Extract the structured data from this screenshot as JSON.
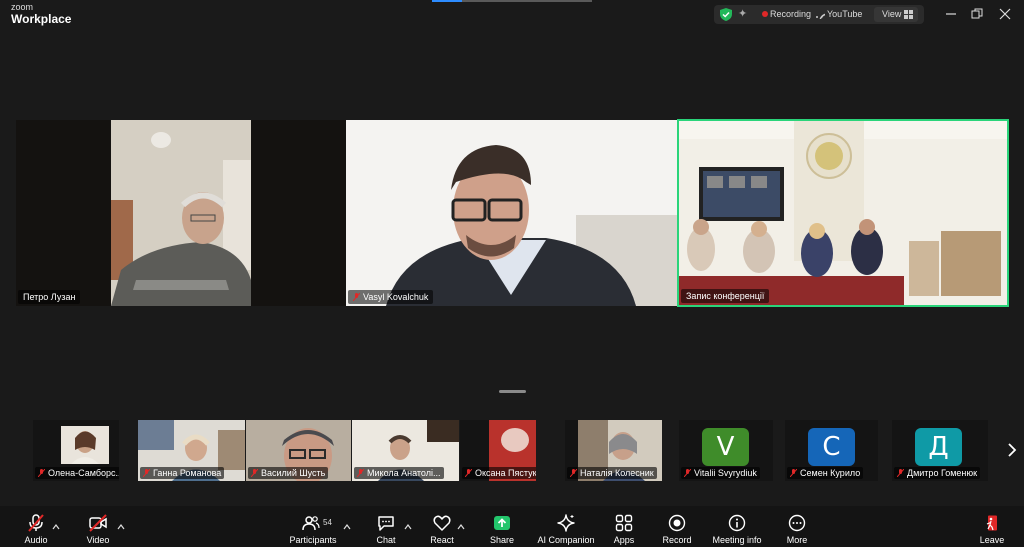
{
  "app": {
    "logo_top": "zoom",
    "logo_bottom": "Workplace"
  },
  "status": {
    "recording": "Recording",
    "stream": "YouTube",
    "view": "View"
  },
  "colors": {
    "active_speaker": "#2ad47a",
    "recording": "#e02828",
    "shield": "#23b85a",
    "share": "#23c66c",
    "leave": "#e02828"
  },
  "tiles": [
    {
      "name": "Петро Лузан",
      "muted": false
    },
    {
      "name": "Vasyl Kovalchuk",
      "muted": true
    },
    {
      "name": "Запис конференції",
      "muted": false,
      "active": true
    }
  ],
  "thumbnails": [
    {
      "name": "Олена-Самборс...",
      "muted": true,
      "type": "video"
    },
    {
      "name": "Ганна Романова",
      "muted": true,
      "type": "video"
    },
    {
      "name": "Василий Шусть",
      "muted": true,
      "type": "video"
    },
    {
      "name": "Микола Анатолі...",
      "muted": true,
      "type": "video"
    },
    {
      "name": "Оксана Пястук",
      "muted": true,
      "type": "video"
    },
    {
      "name": "Наталія Колесник",
      "muted": true,
      "type": "video"
    },
    {
      "name": "Vitalii Svyrydiuk",
      "muted": true,
      "type": "avatar",
      "initial": "V",
      "color": "#3f8c2a"
    },
    {
      "name": "Семен Курило",
      "muted": true,
      "type": "avatar",
      "initial": "С",
      "color": "#1566b8"
    },
    {
      "name": "Дмитро Гоменюк",
      "muted": true,
      "type": "avatar",
      "initial": "Д",
      "color": "#0f9aa6"
    }
  ],
  "toolbar": {
    "audio": "Audio",
    "video": "Video",
    "participants": "Participants",
    "participants_count": "54",
    "chat": "Chat",
    "react": "React",
    "share": "Share",
    "ai_companion": "AI Companion",
    "apps": "Apps",
    "record": "Record",
    "meeting_info": "Meeting info",
    "more": "More",
    "leave": "Leave"
  }
}
